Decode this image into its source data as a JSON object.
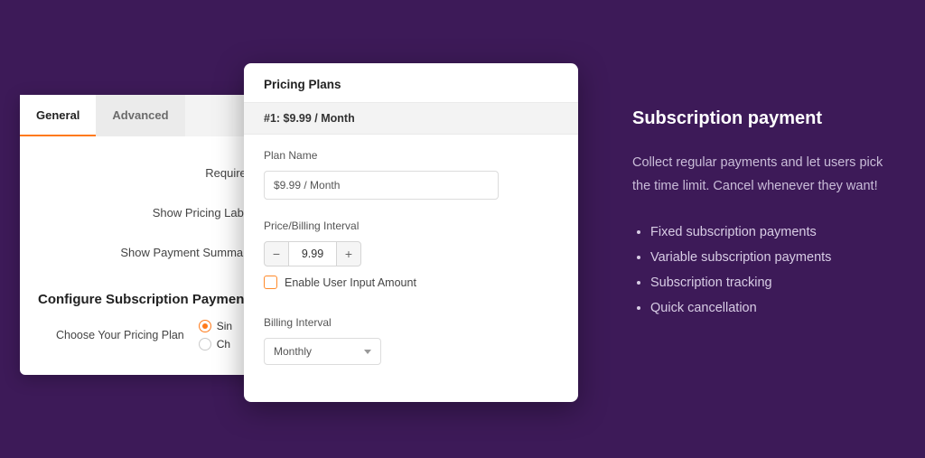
{
  "back_panel": {
    "tabs": {
      "general": "General",
      "advanced": "Advanced"
    },
    "opts": {
      "required": "Required",
      "show_pricing_label": "Show Pricing Label",
      "show_payment_summary": "Show Payment Summary"
    },
    "section_title": "Configure Subscription Payment",
    "choose_label": "Choose Your Pricing Plan",
    "radio_sin": "Sin",
    "radio_ch": "Ch"
  },
  "front_panel": {
    "header": "Pricing Plans",
    "plan_title": "#1: $9.99 / Month",
    "plan_name_label": "Plan Name",
    "plan_name_value": "$9.99 / Month",
    "price_label": "Price/Billing Interval",
    "price_value": "9.99",
    "enable_user_input": "Enable User Input Amount",
    "billing_interval_label": "Billing Interval",
    "billing_interval_value": "Monthly"
  },
  "marketing": {
    "title": "Subscription payment",
    "desc": "Collect regular payments and let users pick the time limit. Cancel whenever they want!",
    "bullets": [
      "Fixed subscription payments",
      "Variable subscription payments",
      "Subscription tracking",
      "Quick cancellation"
    ]
  }
}
